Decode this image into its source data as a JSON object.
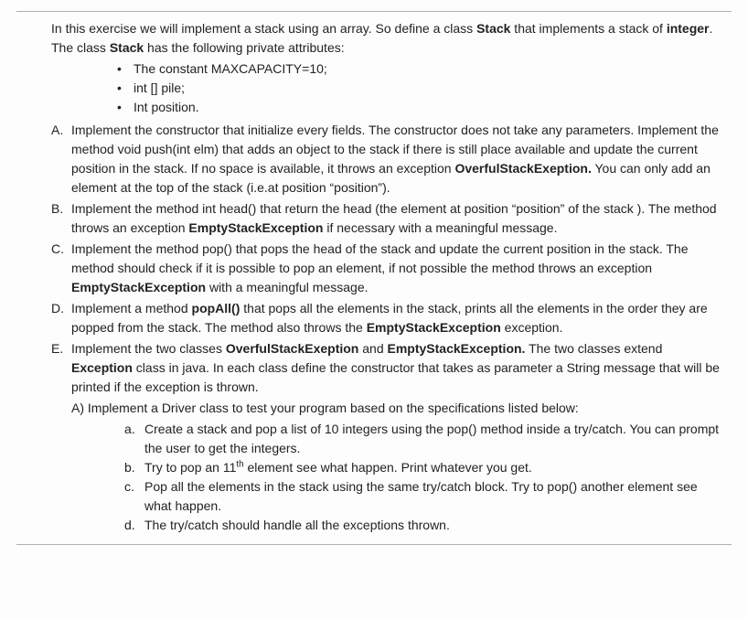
{
  "intro": {
    "l1_a": "In this exercise we will implement a stack using an array. So define a class ",
    "l1_b": "Stack",
    "l1_c": " that implements a stack of ",
    "l1_d": "integer",
    "l1_e": ". The class ",
    "l1_f": "Stack",
    "l1_g": " has the following private attributes:"
  },
  "attrs": [
    "The constant MAXCAPACITY=10;",
    "int [] pile;",
    "Int position."
  ],
  "A": {
    "letter": "A.",
    "t1": "Implement the constructor that initialize every fields. The constructor does not take any parameters. Implement the method void push(int elm) that adds an object to the stack if there is still place available and update the current position in the stack. If no space is available, it throws an exception ",
    "b1": "OverfulStackExeption.",
    "t2": " You can only add an element at the top of the stack (i.e.at position “position”)."
  },
  "B": {
    "letter": "B.",
    "t1": "Implement the method int head() that return the head (the element at position “position” of the stack ). The method throws an exception ",
    "b1": "EmptyStackException",
    "t2": " if necessary with a meaningful message."
  },
  "C": {
    "letter": "C.",
    "t1": "Implement the method pop() that pops the head of the stack and update the current position in the stack. The method should check if it is possible to pop an element, if not possible the method throws an exception ",
    "b1": "EmptyStackException",
    "t2": " with a meaningful message."
  },
  "D": {
    "letter": "D.",
    "t1": "Implement a method ",
    "b1": "popAll()",
    "t2": " that pops all the elements in the stack, prints all the elements in the order they are popped from the stack. The method also throws the ",
    "b2": "EmptyStackException",
    "t3": " exception."
  },
  "E": {
    "letter": "E.",
    "t1": "Implement the two classes ",
    "b1": "OverfulStackExeption",
    "t2": " and ",
    "b2": "EmptyStackException.",
    "t3": " The two classes extend ",
    "b3": "Exception",
    "t4": " class in java. In each class define the constructor that takes as parameter a String message that will be printed if the exception is thrown.",
    "A_inner": "A) Implement a Driver class to test your program based on the specifications listed below:",
    "sub": {
      "a": {
        "letter": "a.",
        "text": "Create a stack and pop a list of 10 integers using the pop() method inside a try/catch. You can prompt the user to get the integers."
      },
      "b": {
        "letter": "b.",
        "pre": "Try to pop an 11",
        "sup": "th",
        "post": " element see what happen. Print whatever you get."
      },
      "c": {
        "letter": "c.",
        "text": "Pop all the elements in the stack using the same try/catch block. Try to pop() another element see what happen."
      },
      "d": {
        "letter": "d.",
        "text": "The try/catch should handle all the exceptions thrown."
      }
    }
  }
}
